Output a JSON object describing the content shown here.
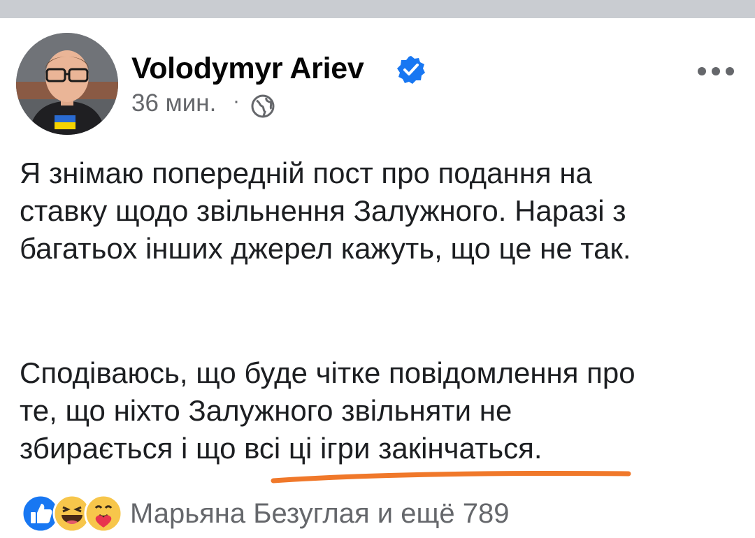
{
  "post": {
    "author": "Volodymyr Ariev",
    "time": "36 мин.",
    "separator": "·",
    "paragraph1": [
      "Я знімаю попередній пост про подання на",
      "ставку щодо звільнення Залужного. Наразі з",
      "багатьох інших джерел кажуть, що це не так."
    ],
    "paragraph2": [
      "Сподіваюсь, що буде чітке повідомлення про",
      "те, що ніхто Залужного звільняти не",
      "збирається і що всі ці ігри закінчаться."
    ]
  },
  "reactions": {
    "icons": [
      "like-icon",
      "haha-icon",
      "care-icon"
    ],
    "summary": "Марьяна Безуглая и ещё 789"
  },
  "colors": {
    "verified": "#1877f2",
    "secondary_text": "#65676b",
    "highlight_underline": "#f0782a",
    "top_band": "#c9ccd1"
  }
}
